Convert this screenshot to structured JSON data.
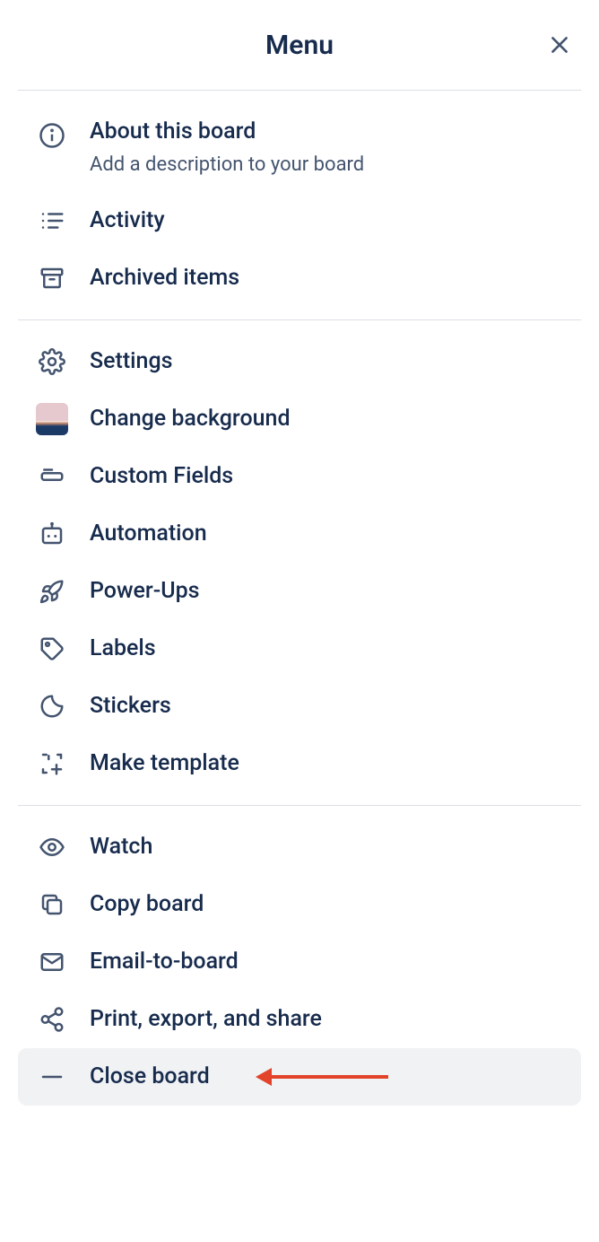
{
  "header": {
    "title": "Menu"
  },
  "section1": {
    "about": {
      "label": "About this board",
      "sub": "Add a description to your board"
    },
    "activity": {
      "label": "Activity"
    },
    "archived": {
      "label": "Archived items"
    }
  },
  "section2": {
    "settings": {
      "label": "Settings"
    },
    "background": {
      "label": "Change background"
    },
    "custom_fields": {
      "label": "Custom Fields"
    },
    "automation": {
      "label": "Automation"
    },
    "powerups": {
      "label": "Power-Ups"
    },
    "labels": {
      "label": "Labels"
    },
    "stickers": {
      "label": "Stickers"
    },
    "template": {
      "label": "Make template"
    }
  },
  "section3": {
    "watch": {
      "label": "Watch"
    },
    "copy": {
      "label": "Copy board"
    },
    "email": {
      "label": "Email-to-board"
    },
    "print": {
      "label": "Print, export, and share"
    },
    "close": {
      "label": "Close board"
    }
  },
  "annotation": {
    "arrow_color": "#e2432a"
  }
}
